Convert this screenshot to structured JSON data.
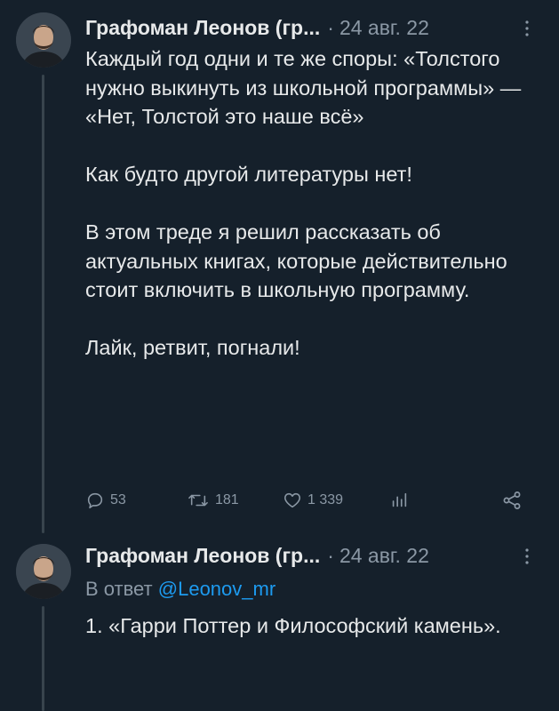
{
  "tweets": [
    {
      "author_name": "Графоман Леонов (гр...",
      "date": "24 авг. 22",
      "paragraphs": [
        "Каждый год одни и те же споры: «Толстого нужно выкинуть из школьной программы» — «Нет, Толстой это наше всё»",
        "Как будто другой литературы нет!",
        "В этом треде я решил рассказать об актуальных книгах, которые действительно стоит включить в школьную программу.",
        "Лайк, ретвит, погнали!"
      ],
      "stats": {
        "replies": "53",
        "retweets": "181",
        "likes": "1 339"
      }
    },
    {
      "author_name": "Графоман Леонов (гр...",
      "date": "24 авг. 22",
      "reply_prefix": "В ответ",
      "reply_handle": "@Leonov_mr",
      "paragraphs": [
        "1. «Гарри Поттер и Философский камень»."
      ]
    }
  ],
  "icons": {
    "more": "more-vertical-icon",
    "reply": "reply-bubble-icon",
    "retweet": "retweet-icon",
    "like": "heart-icon",
    "analytics": "bar-chart-icon",
    "share": "share-icon"
  },
  "colors": {
    "background": "#15202b",
    "text": "#e7e9ea",
    "muted": "#8b98a5",
    "link": "#1d9bf0",
    "thread_line": "#38444d"
  }
}
